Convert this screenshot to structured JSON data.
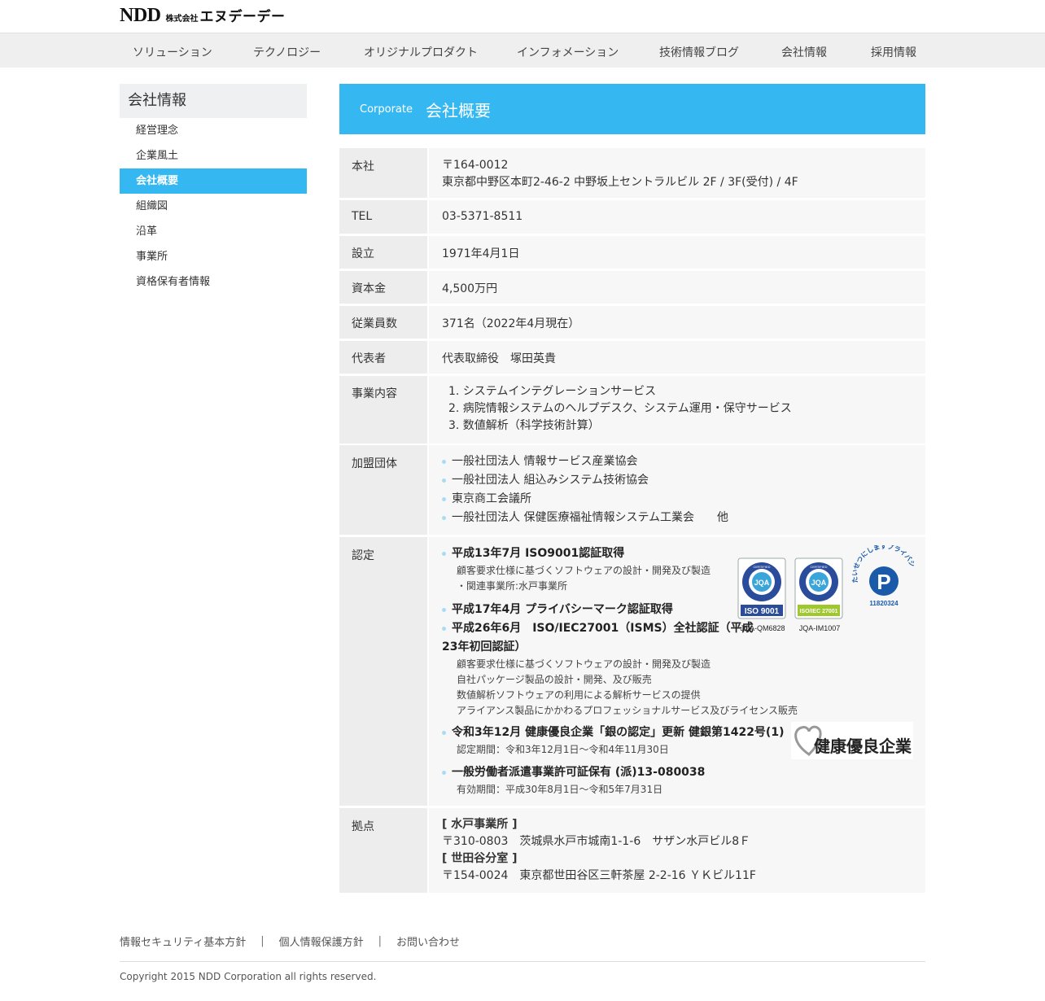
{
  "logo": {
    "ndd": "NDD",
    "kabu": "株式会社",
    "name": "エヌデーデー"
  },
  "nav": [
    "ソリューション",
    "テクノロジー",
    "オリジナルプロダクト",
    "インフォメーション",
    "技術情報ブログ",
    "会社情報",
    "採用情報"
  ],
  "sidebar": {
    "title": "会社情報",
    "items": [
      "経営理念",
      "企業風土",
      "会社概要",
      "組織図",
      "沿革",
      "事業所",
      "資格保有者情報"
    ]
  },
  "banner": {
    "en": "Corporate",
    "jp": "会社概要"
  },
  "table": {
    "hq_label": "本社",
    "hq_zip": "〒164-0012",
    "hq_addr": "東京都中野区本町2-46-2 中野坂上セントラルビル 2F / 3F(受付) / 4F",
    "tel_label": "TEL",
    "tel": "03-5371-8511",
    "est_label": "設立",
    "est": "1971年4月1日",
    "cap_label": "資本金",
    "cap": "4,500万円",
    "emp_label": "従業員数",
    "emp": "371名（2022年4月現在）",
    "rep_label": "代表者",
    "rep": "代表取締役　塚田英貴",
    "biz_label": "事業内容",
    "biz": [
      "1. システムインテグレーションサービス",
      "2. 病院情報システムのヘルプデスク、システム運用・保守サービス",
      "3. 数値解析（科学技術計算）"
    ],
    "mem_label": "加盟団体",
    "mem": [
      "一般社団法人 情報サービス産業協会",
      "一般社団法人 組込みシステム技術協会",
      "東京商工会議所",
      "一般社団法人 保健医療福祉情報システム工業会　　他"
    ],
    "cert_label": "認定",
    "cert1_title": "平成13年7月 ISO9001認証取得",
    "cert1_sub": [
      "顧客要求仕様に基づくソフトウェアの設計・開発及び製造",
      "・関連事業所:水戸事業所"
    ],
    "cert2_title": "平成17年4月 プライバシーマーク認証取得",
    "cert3_title_a": "平成26年6月　ISO/IEC27001（ISMS）全社認証（平成",
    "cert3_title_b": "23年初回認証）",
    "cert3_sub": [
      "顧客要求仕様に基づくソフトウェアの設計・開発及び製造",
      "自社パッケージ製品の設計・開発、及び販売",
      "数値解析ソフトウェアの利用による解析サービスの提供",
      "アライアンス製品にかかわるプロフェッショナルサービス及びライセンス販売"
    ],
    "cert4_title": "令和3年12月 健康優良企業「銀の認定」更新 健銀第1422号(1)",
    "cert4_sub": "認定期間：令和3年12月1日～令和4年11月30日",
    "cert5_title": "一般労働者派遣事業許可証保有 (派)13-080038",
    "cert5_sub": "有効期間：平成30年8月1日～令和5年7月31日",
    "loc_label": "拠点",
    "loc1_name": "[ 水戸事業所 ]",
    "loc1_addr": "〒310-0803　茨城県水戸市城南1-1-6　サザン水戸ビル8Ｆ",
    "loc2_name": "[ 世田谷分室 ]",
    "loc2_addr": "〒154-0024　東京都世田谷区三軒茶屋 2-2-16 ＹＫビル11F"
  },
  "badges": {
    "iso9001_text": "ISO 9001",
    "iso9001_code": "JQA-QM6828",
    "iso27001_text": "ISO/IEC 27001",
    "iso27001_code": "JQA-IM1007",
    "jqa": "JQA",
    "certified": "CERTIFIED",
    "pmark_arc": "たいせつにしますプライバシー",
    "pmark_num": "11820324",
    "kenko": "健康優良企業"
  },
  "footer": {
    "links": [
      "情報セキュリティ基本方針",
      "個人情報保護方針",
      "お問い合わせ"
    ],
    "copyright": "Copyright 2015 NDD Corporation all rights reserved."
  }
}
